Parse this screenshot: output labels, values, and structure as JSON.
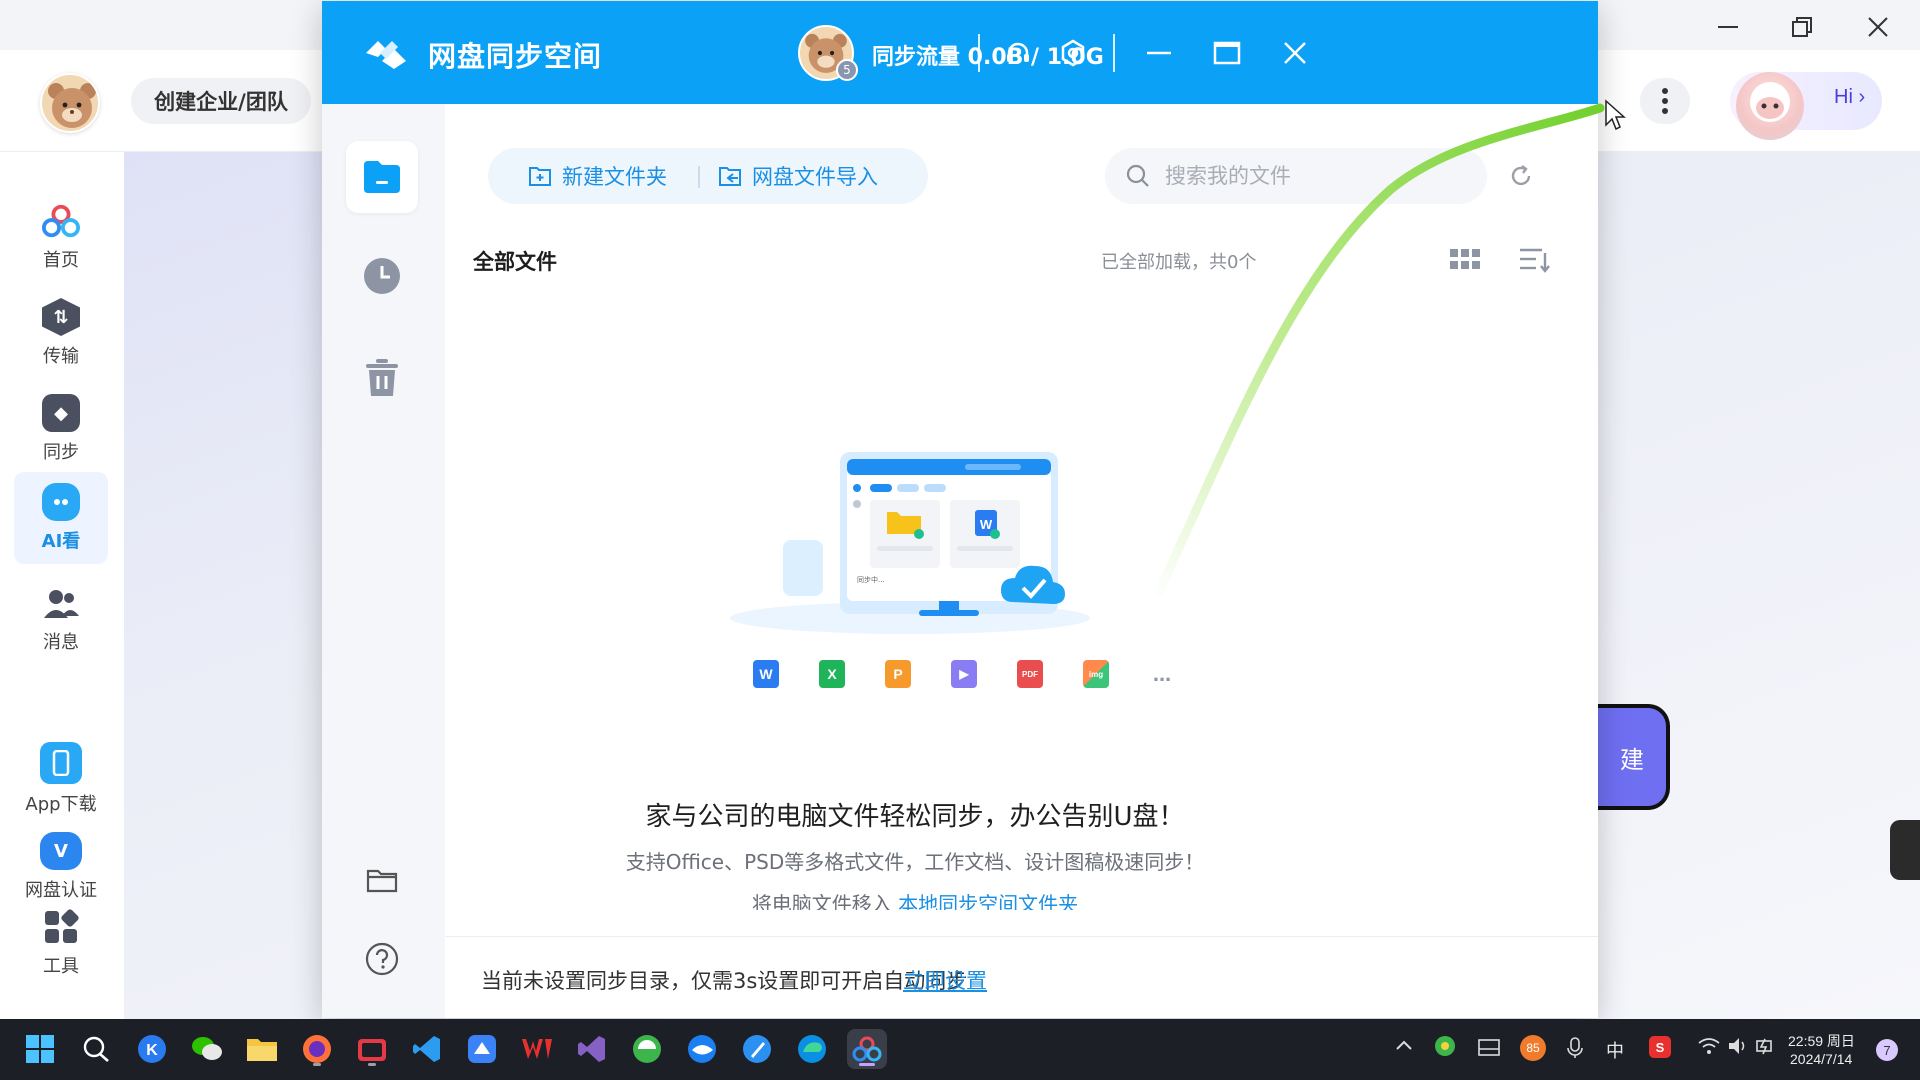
{
  "background_app": {
    "team_button": "创建企业/团队",
    "hi_label": "Hi",
    "create_partial": "建",
    "sidebar": [
      {
        "label": "首页",
        "icon": "baidu-cloud-icon"
      },
      {
        "label": "传输",
        "icon": "transfer-icon"
      },
      {
        "label": "同步",
        "icon": "sync-icon"
      },
      {
        "label": "AI看",
        "icon": "ai-look-icon",
        "active": true
      },
      {
        "label": "消息",
        "icon": "message-icon"
      },
      {
        "label": "App下载",
        "icon": "phone-icon"
      },
      {
        "label": "网盘认证",
        "icon": "verify-icon"
      },
      {
        "label": "工具",
        "icon": "tools-icon"
      }
    ]
  },
  "dialog": {
    "title": "网盘同步空间",
    "traffic": "同步流量 0.0B / 1.0G",
    "badge": "5",
    "toolbar": {
      "new_folder": "新建文件夹",
      "import": "网盘文件导入"
    },
    "search": {
      "placeholder": "搜索我的文件"
    },
    "breadcrumb": "全部文件",
    "load_status": "已全部加载，共0个",
    "illustration": {
      "syncing_text": "同步中..."
    },
    "file_types": [
      "W",
      "X",
      "P",
      "▶",
      "PDF",
      "img",
      "..."
    ],
    "slogan": "家与公司的电脑文件轻松同步，办公告别U盘！",
    "sub_slogan": "支持Office、PSD等多格式文件，工作文档、设计图稿极速同步！",
    "move_hint_prefix": "将电脑文件移入",
    "move_hint_link": "本地同步空间文件夹",
    "footer": {
      "text": "当前未设置同步目录，仅需3s设置即可开启自动同步",
      "link": "立即设置"
    }
  },
  "taskbar": {
    "time": "22:59 周日",
    "date": "2024/7/14",
    "ime": "中",
    "badge_85": "85",
    "notification_count": "7"
  },
  "colors": {
    "accent": "#0aa1f7",
    "link": "#1a8fe3",
    "stroke": "#8fdc3c"
  }
}
